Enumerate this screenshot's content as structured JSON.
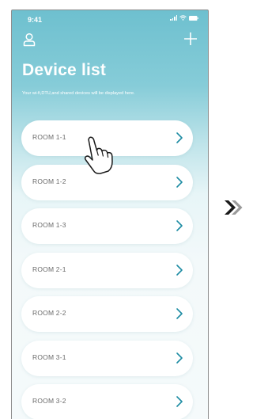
{
  "status_bar": {
    "time": "9:41"
  },
  "header": {
    "title": "Device list",
    "subtitle": "Your wi-fi,DTU,and shared devices will be displayed here."
  },
  "icons": {
    "user": "user-icon",
    "add": "plus-icon",
    "chevron": "chevron-right-icon",
    "pointer": "tap-hand-icon",
    "next": "double-chevron-right-icon"
  },
  "rooms": [
    {
      "label": "ROOM 1-1"
    },
    {
      "label": "ROOM 1-2"
    },
    {
      "label": "ROOM 1-3"
    },
    {
      "label": "ROOM 2-1"
    },
    {
      "label": "ROOM 2-2"
    },
    {
      "label": "ROOM 3-1"
    },
    {
      "label": "ROOM 3-2"
    }
  ],
  "colors": {
    "accent": "#6ec0cf",
    "chevron": "#1d8ca3",
    "label": "#6a6a6a",
    "next_arrow_dark": "#1a1a1a",
    "next_arrow_light": "#9a9a9a"
  }
}
